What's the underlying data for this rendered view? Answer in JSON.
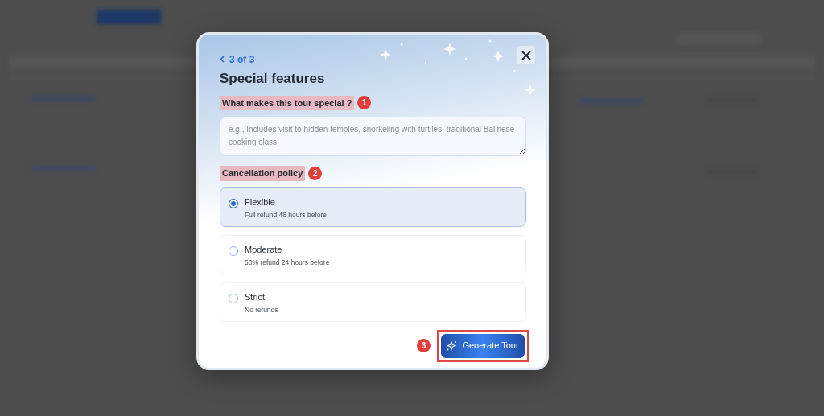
{
  "modal": {
    "step": "3 of 3",
    "title": "Special features",
    "question": {
      "label": "What makes this tour special ?",
      "marker": "1",
      "placeholder": "e.g., Includes visit to hidden temples, snorkeling with turtiles, traditional Balinese cooking class"
    },
    "cancellation": {
      "label": "Cancellation policy",
      "marker": "2",
      "options": [
        {
          "title": "Flexible",
          "description": "Full refund 48 hours before",
          "selected": true
        },
        {
          "title": "Moderate",
          "description": "50% refund 24 hours before",
          "selected": false
        },
        {
          "title": "Strict",
          "description": "No refunds",
          "selected": false
        }
      ]
    },
    "action": {
      "marker": "3",
      "label": "Generate Tour"
    }
  }
}
